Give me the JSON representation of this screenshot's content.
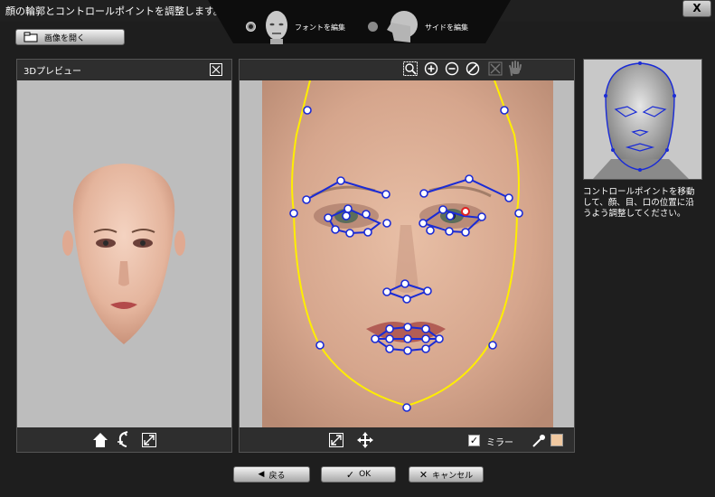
{
  "window": {
    "title": "顔の輪郭とコントロールポイントを調整します。",
    "close_label": "X"
  },
  "mode_tabs": {
    "front_label": "フォントを編集",
    "side_label": "サイドを編集"
  },
  "toolbar": {
    "open_image_label": "画像を開く"
  },
  "preview_panel": {
    "title": "3Dプレビュー",
    "tools": [
      "home-icon",
      "rotate-icon",
      "resize-icon"
    ]
  },
  "editor_panel": {
    "top_tools": [
      "zoom-region-icon",
      "zoom-in-icon",
      "zoom-out-icon",
      "no-icon",
      "fit-icon",
      "hand-icon"
    ],
    "bottom_tools": [
      "fit-icon",
      "move-icon"
    ],
    "mirror_label": "ミラー",
    "mirror_checked": true,
    "color_swatch": "#f0c8a0",
    "contour_color": "#ffee00",
    "feature_line_color": "#1a2bd6"
  },
  "instructions": "コントロールポイントを移動して、顔、目、口の位置に沿うよう調整してください。",
  "footer": {
    "back_label": "戻る",
    "ok_label": "OK",
    "cancel_label": "キャンセル"
  }
}
